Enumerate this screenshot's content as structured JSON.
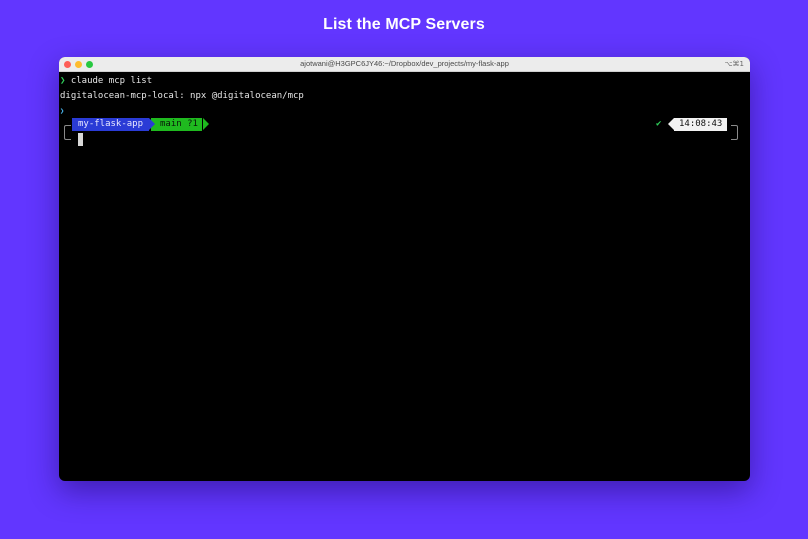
{
  "page": {
    "heading": "List the MCP Servers",
    "background_color": "#6236FF"
  },
  "window": {
    "title": "ajotwani@H3GPC6JY46:~/Dropbox/dev_projects/my-flask-app",
    "shortcut": "⌥⌘1",
    "traffic_lights": [
      "close",
      "minimize",
      "maximize"
    ]
  },
  "terminal": {
    "lines": [
      {
        "prompt": "❯",
        "text": " claude mcp list"
      },
      {
        "text": "digitalocean-mcp-local: npx @digitalocean/mcp"
      },
      {
        "prompt": "❯",
        "text": ""
      }
    ],
    "prompt_bar": {
      "directory": "my-flask-app",
      "git_branch": "main ?1",
      "status_icon": "✔",
      "time": "14:08:43"
    },
    "colors": {
      "directory_segment": "#2a3bd6",
      "git_segment": "#1fba1f",
      "time_segment": "#f2f2f2",
      "prompt": "#2fd05a"
    }
  }
}
